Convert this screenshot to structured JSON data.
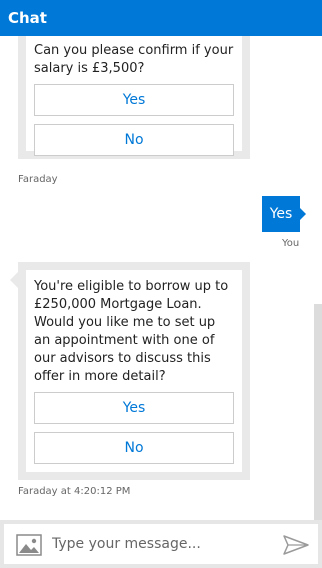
{
  "header": {
    "title": "Chat"
  },
  "messages": [
    {
      "text": "Can you please confirm if your salary is £3,500?",
      "buttons": [
        "Yes",
        "No"
      ],
      "meta": "Faraday"
    },
    {
      "text": "Yes",
      "meta": "You"
    },
    {
      "text": "You're eligible to borrow up to £250,000 Mortgage Loan. Would you like me to set up an appointment with one of our advisors to discuss this offer in more detail?",
      "buttons": [
        "Yes",
        "No"
      ],
      "meta": "Faraday at 4:20:12 PM"
    }
  ],
  "composer": {
    "placeholder": "Type your message...",
    "upload_icon": "image-icon",
    "send_icon": "send-icon"
  },
  "colors": {
    "accent": "#0078d7",
    "card_frame": "#e9e9e9",
    "footer": "#e6e6e6"
  }
}
